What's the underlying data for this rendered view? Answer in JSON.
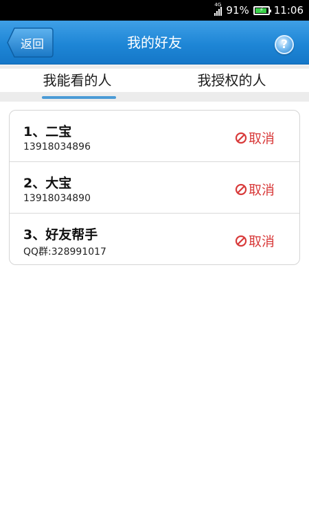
{
  "status_bar": {
    "network": "4G",
    "battery": "91%",
    "battery_level": 0.91,
    "time": "11:06"
  },
  "header": {
    "back_label": "返回",
    "title": "我的好友",
    "help_symbol": "?"
  },
  "tabs": [
    {
      "label": "我能看的人",
      "active": true
    },
    {
      "label": "我授权的人",
      "active": false
    }
  ],
  "friends": [
    {
      "name": "1、二宝",
      "detail": "13918034896",
      "action": "取消"
    },
    {
      "name": "2、大宝",
      "detail": "13918034890",
      "action": "取消"
    },
    {
      "name": "3、好友帮手",
      "detail": "QQ群:328991017",
      "action": "取消"
    }
  ],
  "colors": {
    "title_bar": "#1e86d6",
    "tab_indicator": "#4a9bd6",
    "cancel": "#d83a3a"
  }
}
